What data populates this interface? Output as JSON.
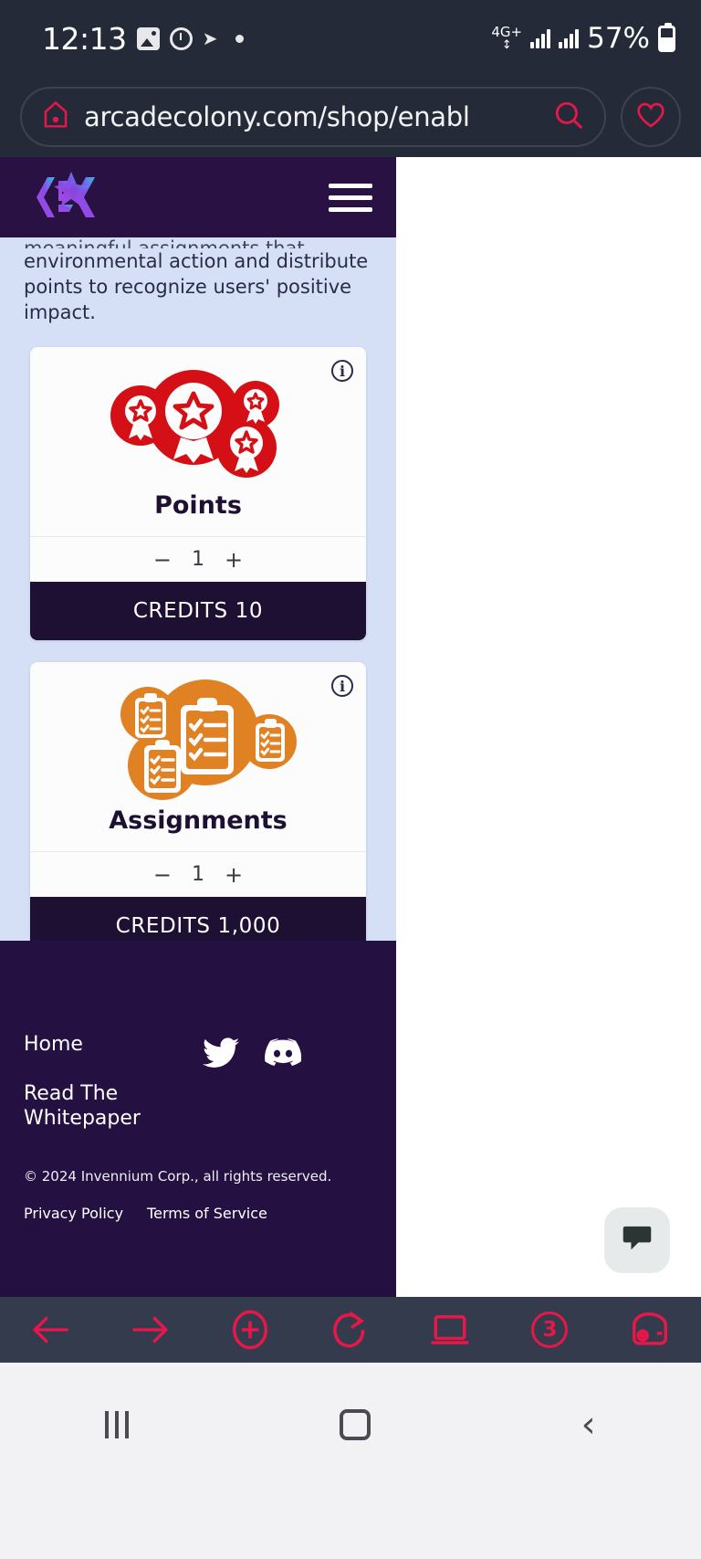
{
  "status_bar": {
    "time": "12:13",
    "network_type": "4G+",
    "battery": "57%",
    "icons": [
      "photo-icon",
      "alarm-clock-icon",
      "paper-plane-icon",
      "dot-icon",
      "signal-bars-icon",
      "signal-bars-icon",
      "battery-icon"
    ]
  },
  "browser": {
    "url": "arcadecolony.com/shop/enabl",
    "home_icon": "home-icon",
    "search_icon": "search-icon",
    "favorite_icon": "heart-icon",
    "bottom_nav": [
      {
        "name": "back",
        "icon": "arrow-left-icon",
        "label": ""
      },
      {
        "name": "forward",
        "icon": "arrow-right-icon",
        "label": ""
      },
      {
        "name": "new-tab",
        "icon": "plus-circle-icon",
        "label": ""
      },
      {
        "name": "reload",
        "icon": "reload-icon",
        "label": ""
      },
      {
        "name": "desktop-mode",
        "icon": "laptop-icon",
        "label": ""
      },
      {
        "name": "tabs",
        "icon": "tab-count-icon",
        "label": "3"
      },
      {
        "name": "wallet",
        "icon": "wallet-icon",
        "label": ""
      }
    ]
  },
  "site": {
    "logo_alt": "arcade-colony-logo",
    "menu_icon": "hamburger-menu-icon",
    "intro": {
      "clipped_line": "meaningful assignments that inspire",
      "text": "environmental action and distribute points to recognize users' positive impact."
    },
    "products": [
      {
        "title": "Points",
        "icon": "award-medals-icon",
        "info_icon": "info-icon",
        "info_label": "i",
        "quantity": "1",
        "decrement_label": "−",
        "increment_label": "+",
        "credits_label": "CREDITS 10",
        "accent": "#d41016"
      },
      {
        "title": "Assignments",
        "icon": "clipboard-checklist-icon",
        "info_icon": "info-icon",
        "info_label": "i",
        "quantity": "1",
        "decrement_label": "−",
        "increment_label": "+",
        "credits_label": "CREDITS 1,000",
        "accent": "#e08224"
      }
    ],
    "footer": {
      "links": [
        {
          "label": "Home"
        },
        {
          "label": "Read The Whitepaper"
        }
      ],
      "social": [
        {
          "name": "twitter-icon"
        },
        {
          "name": "discord-icon"
        }
      ],
      "copyright": "© 2024 Invennium Corp., all rights reserved.",
      "legal": [
        {
          "label": "Privacy Policy"
        },
        {
          "label": "Terms of Service"
        }
      ]
    }
  },
  "chat_widget": {
    "icon": "chat-bubble-icon"
  },
  "android_nav": {
    "recent_icon": "recent-apps-icon",
    "home_icon": "home-square-icon",
    "back_icon": "back-chevron-icon"
  },
  "colors": {
    "status_bg": "#242a38",
    "header_bg": "#2a1144",
    "page_bg": "#d5e0f7",
    "footer_bg": "#241041",
    "accent_red": "#e8174a",
    "credits_bg": "#1d1033"
  }
}
